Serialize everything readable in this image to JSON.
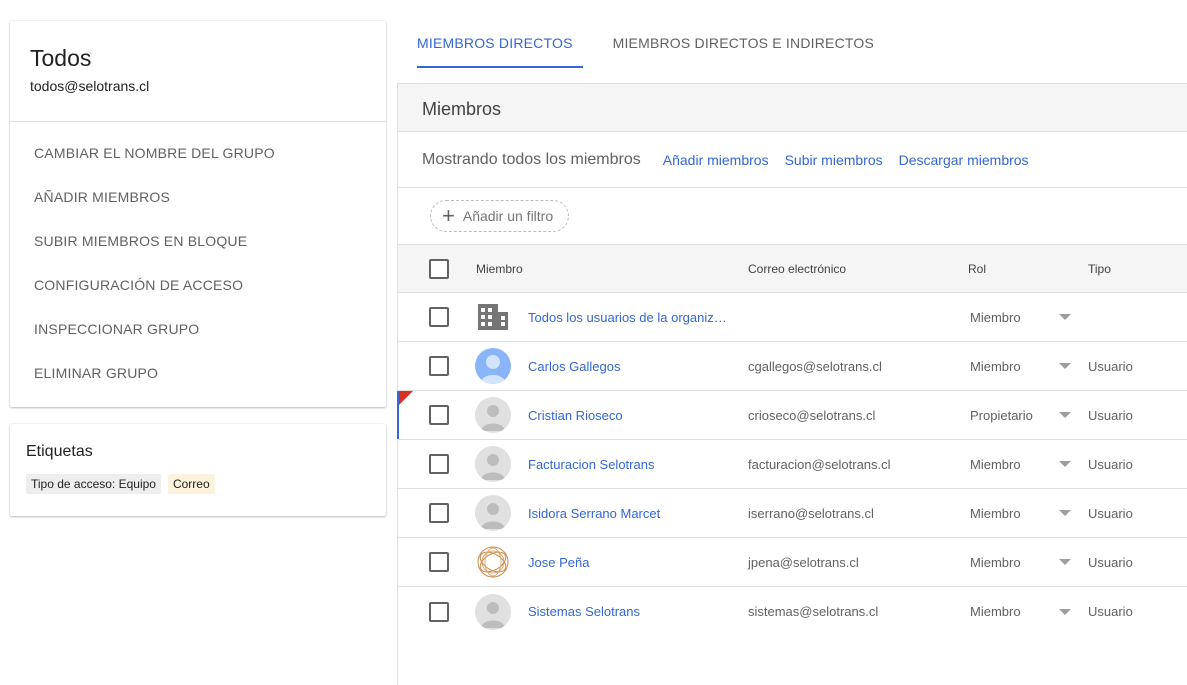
{
  "group": {
    "name": "Todos",
    "email": "todos@selotrans.cl",
    "actions": [
      "CAMBIAR EL NOMBRE DEL GRUPO",
      "AÑADIR MIEMBROS",
      "SUBIR MIEMBROS EN BLOQUE",
      "CONFIGURACIÓN DE ACCESO",
      "INSPECCIONAR GRUPO",
      "ELIMINAR GRUPO"
    ]
  },
  "labels": {
    "title": "Etiquetas",
    "chips": [
      "Tipo de acceso: Equipo",
      "Correo"
    ]
  },
  "tabs": [
    {
      "label": "MIEMBROS DIRECTOS",
      "active": true
    },
    {
      "label": "MIEMBROS DIRECTOS E INDIRECTOS",
      "active": false
    }
  ],
  "members": {
    "panel_title": "Miembros",
    "showing": "Mostrando todos los miembros",
    "links": [
      "Añadir miembros",
      "Subir miembros",
      "Descargar miembros"
    ],
    "filter_label": "Añadir un filtro",
    "columns": {
      "member": "Miembro",
      "email": "Correo electrónico",
      "role": "Rol",
      "type": "Tipo"
    },
    "rows": [
      {
        "name": "Todos los usuarios de la organiz…",
        "email": "",
        "role": "Miembro",
        "type": "",
        "avatar": "building-icon"
      },
      {
        "name": "Carlos Gallegos",
        "email": "cgallegos@selotrans.cl",
        "role": "Miembro",
        "type": "Usuario",
        "avatar": "user-photo"
      },
      {
        "name": "Cristian Rioseco",
        "email": "crioseco@selotrans.cl",
        "role": "Propietario",
        "type": "Usuario",
        "avatar": "person-icon"
      },
      {
        "name": "Facturacion Selotrans",
        "email": "facturacion@selotrans.cl",
        "role": "Miembro",
        "type": "Usuario",
        "avatar": "person-icon"
      },
      {
        "name": "Isidora Serrano Marcet",
        "email": "iserrano@selotrans.cl",
        "role": "Miembro",
        "type": "Usuario",
        "avatar": "person-icon"
      },
      {
        "name": "Jose Peña",
        "email": "jpena@selotrans.cl",
        "role": "Miembro",
        "type": "Usuario",
        "avatar": "spiral-logo"
      },
      {
        "name": "Sistemas Selotrans",
        "email": "sistemas@selotrans.cl",
        "role": "Miembro",
        "type": "Usuario",
        "avatar": "person-icon"
      }
    ]
  },
  "colors": {
    "accent": "#3367d6",
    "flag": "#d93025"
  }
}
